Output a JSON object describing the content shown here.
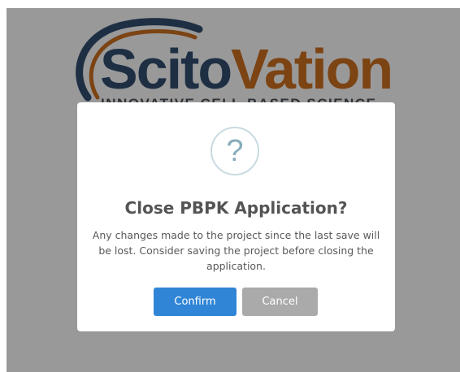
{
  "logo": {
    "word_part1": "Scito",
    "word_part2": "Vation",
    "tagline": "INNOVATIVE CELL-BASED SCIENCE"
  },
  "dialog": {
    "icon": "?",
    "icon_name": "question-icon",
    "title": "Close PBPK Application?",
    "message": "Any changes made to the project since the last save will be lost. Consider saving the project before closing the application.",
    "confirm_label": "Confirm",
    "cancel_label": "Cancel"
  },
  "colors": {
    "overlay": "#999999",
    "confirm_button": "#3085d6",
    "cancel_button": "#aaaaaa",
    "title_text": "#545454",
    "icon_ring": "#c9dae1",
    "logo_navy": "#1e2f44",
    "logo_brown": "#7c4313"
  }
}
